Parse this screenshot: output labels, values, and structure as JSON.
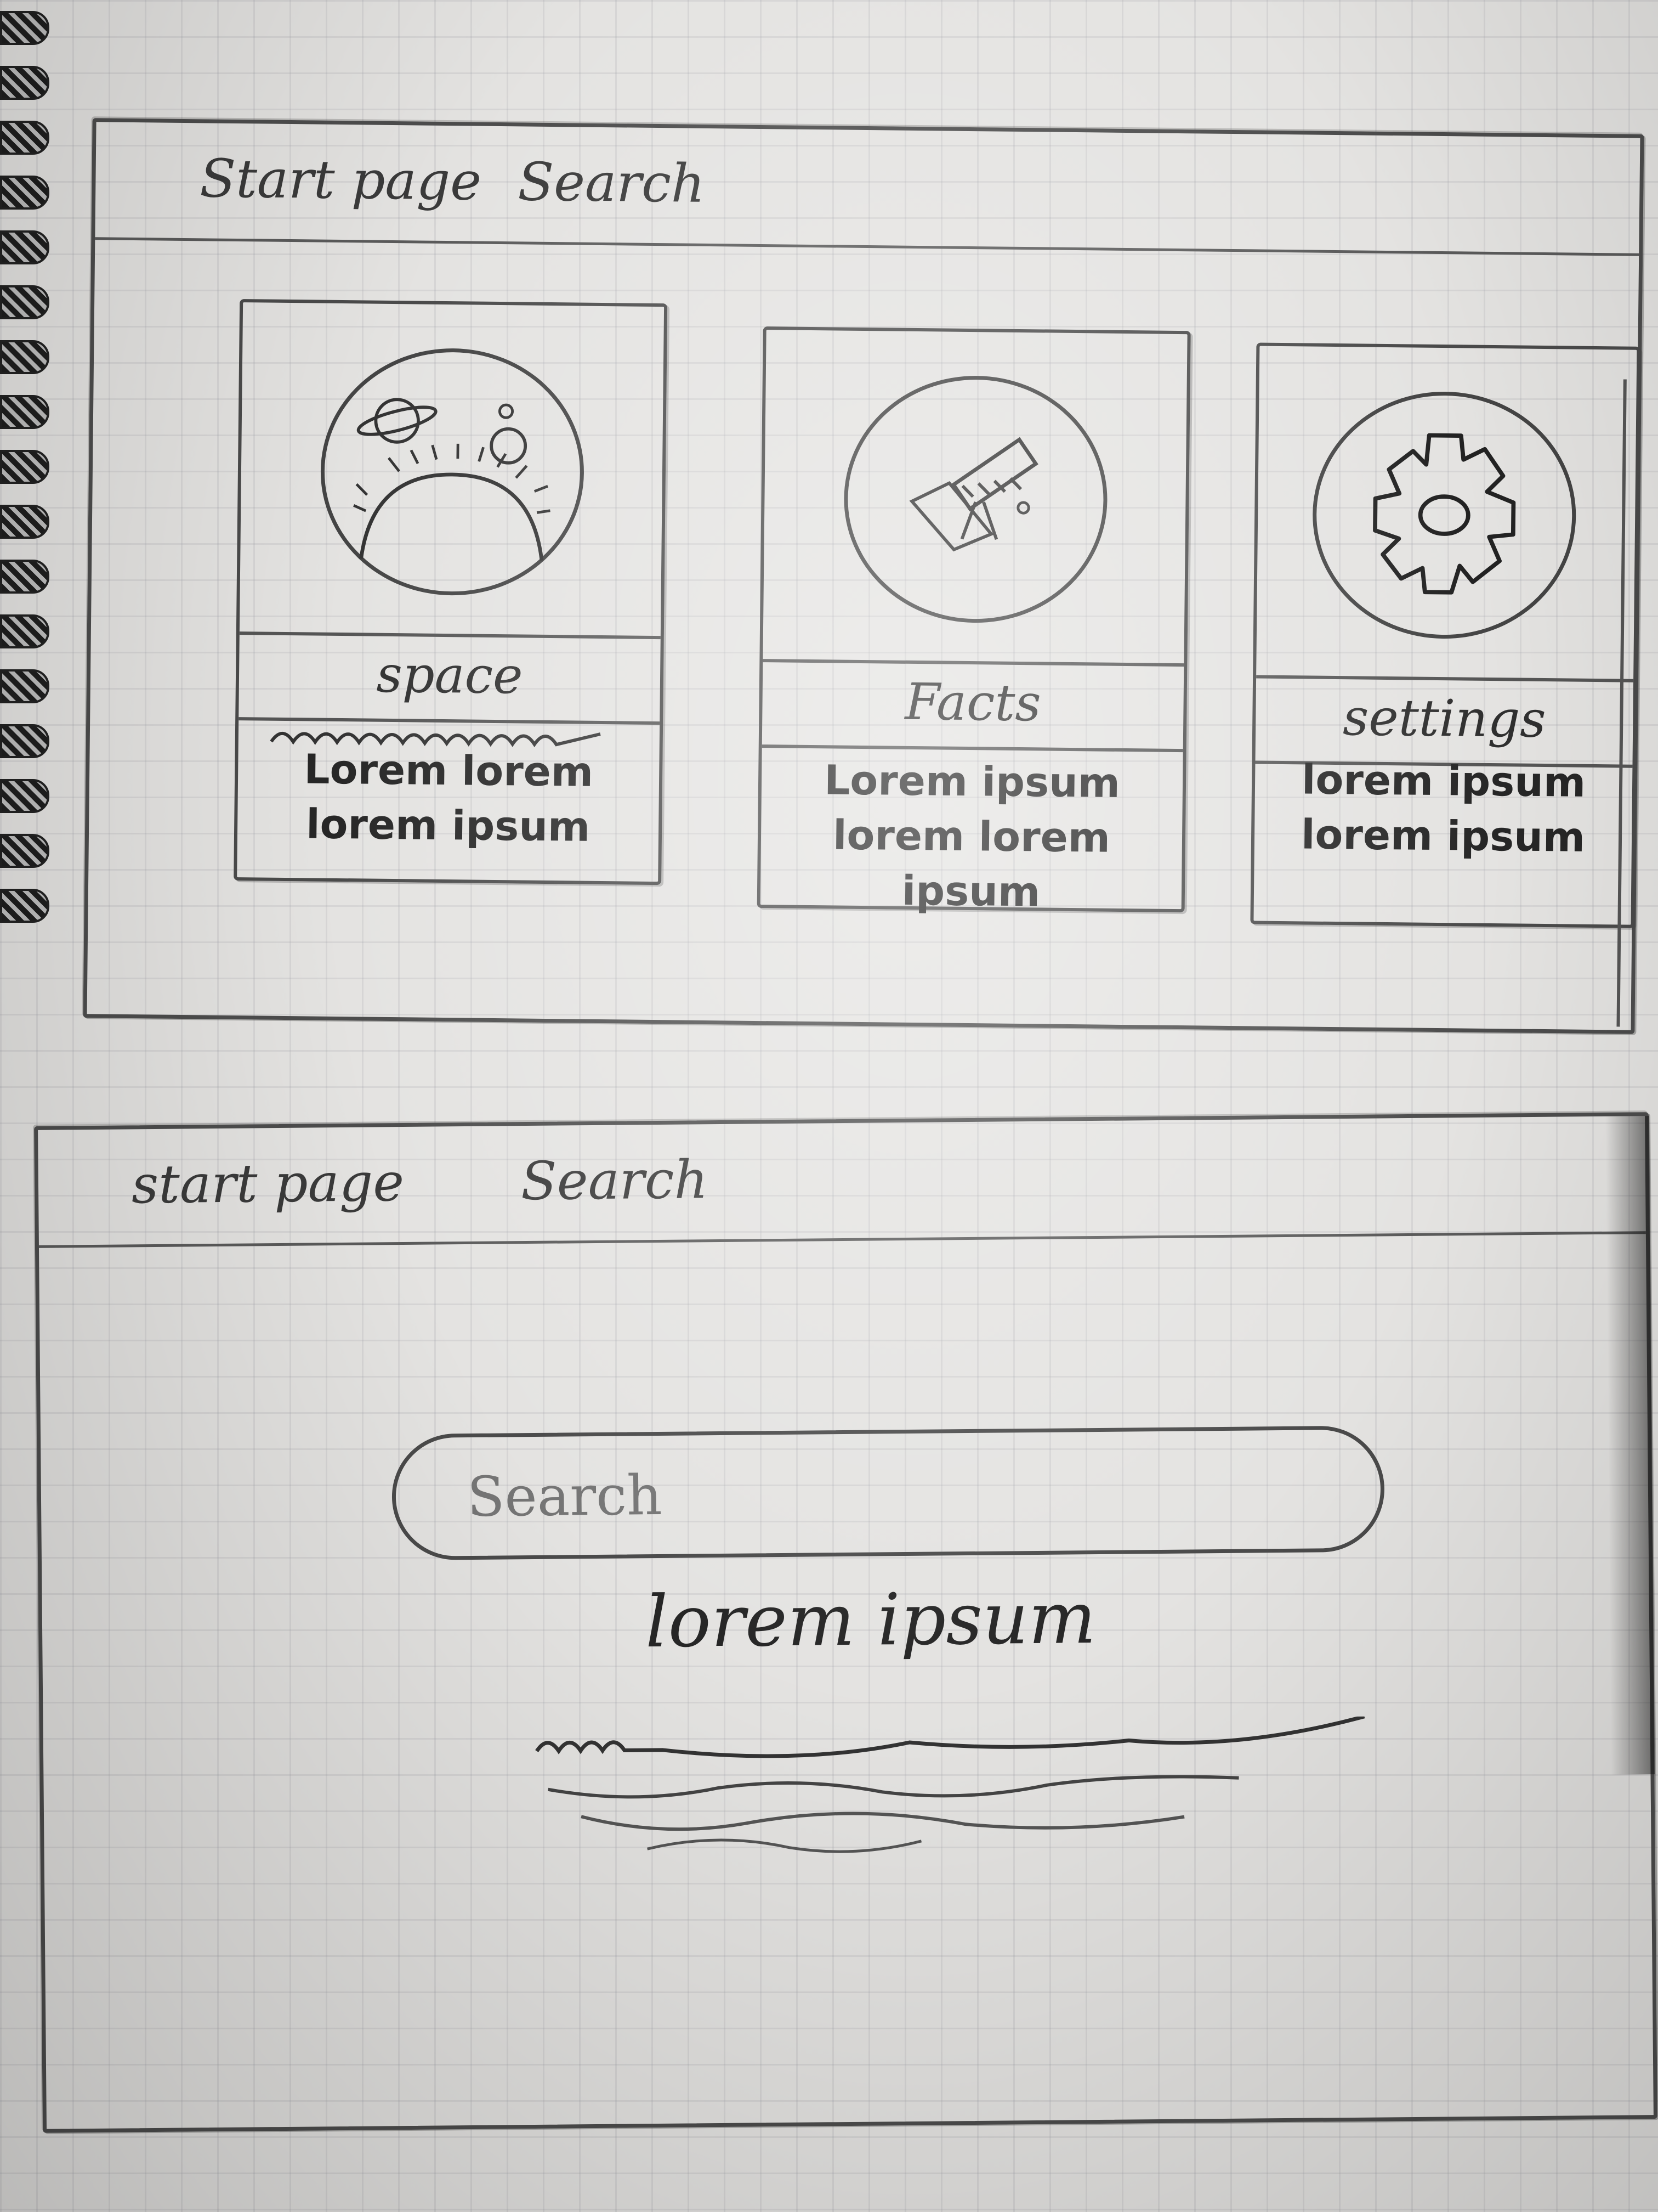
{
  "top_screen": {
    "nav": {
      "start_page": "Start page",
      "search": "Search"
    },
    "cards": [
      {
        "icon": "planet-icon",
        "title": "space",
        "description": "Lorem lorem lorem ipsum"
      },
      {
        "icon": "telescope-icon",
        "title": "Facts",
        "description": "Lorem ipsum lorem lorem ipsum"
      },
      {
        "icon": "gear-icon",
        "title": "settings",
        "description": "lorem ipsum lorem ipsum"
      }
    ]
  },
  "bottom_screen": {
    "nav": {
      "start_page": "start page",
      "search": "Search"
    },
    "search_input": {
      "placeholder": "Search"
    },
    "result": {
      "title": "lorem ipsum"
    }
  }
}
